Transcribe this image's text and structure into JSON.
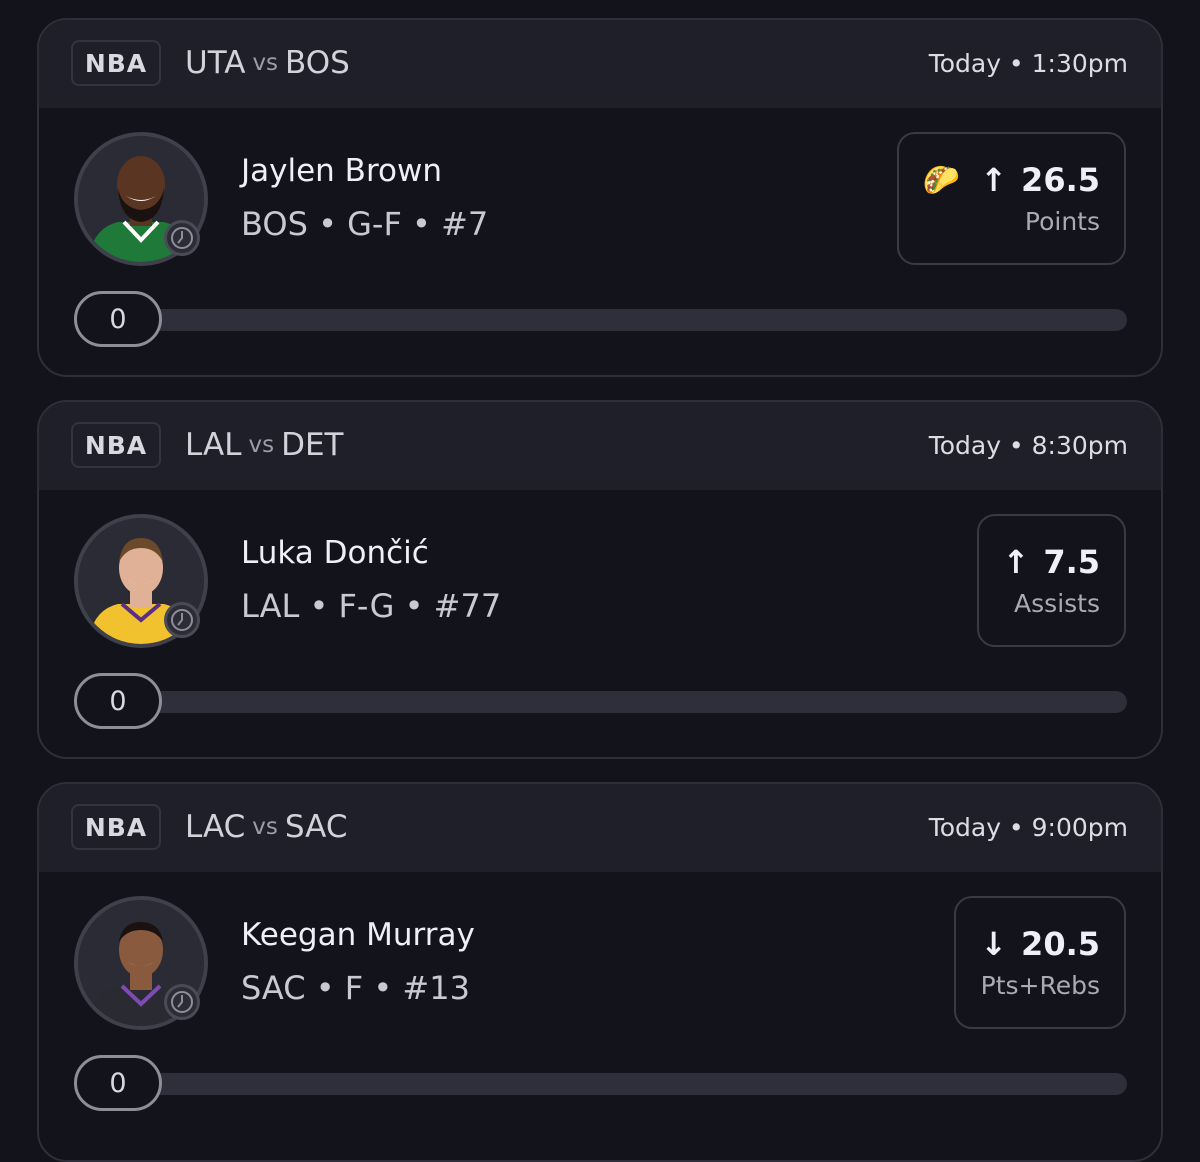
{
  "props": [
    {
      "league": "NBA",
      "home": "UTA",
      "vs": "vs",
      "away": "BOS",
      "time": "Today • 1:30pm",
      "player": "Jaylen Brown",
      "info": "BOS • G-F • #7",
      "emoji": "🌮",
      "arrow": "↑",
      "line": "26.5",
      "stat": "Points",
      "progress_value": "0",
      "progress_fraction": 0,
      "jersey_color": "#1f7a3a",
      "skin_color": "#5a3522"
    },
    {
      "league": "NBA",
      "home": "LAL",
      "vs": "vs",
      "away": "DET",
      "time": "Today • 8:30pm",
      "player": "Luka Dončić",
      "info": "LAL • F-G • #77",
      "emoji": "",
      "arrow": "↑",
      "line": "7.5",
      "stat": "Assists",
      "progress_value": "0",
      "progress_fraction": 0,
      "jersey_color": "#f2c12e",
      "skin_color": "#e0b197"
    },
    {
      "league": "NBA",
      "home": "LAC",
      "vs": "vs",
      "away": "SAC",
      "time": "Today • 9:00pm",
      "player": "Keegan Murray",
      "info": "SAC • F • #13",
      "emoji": "",
      "arrow": "↓",
      "line": "20.5",
      "stat": "Pts+Rebs",
      "progress_value": "0",
      "progress_fraction": 0,
      "jersey_color": "#2a2a33",
      "skin_color": "#8a5a3e"
    }
  ],
  "icons": {
    "avatar_status": "clock-icon",
    "direction_up": "arrow-up-icon",
    "direction_down": "arrow-down-icon"
  }
}
